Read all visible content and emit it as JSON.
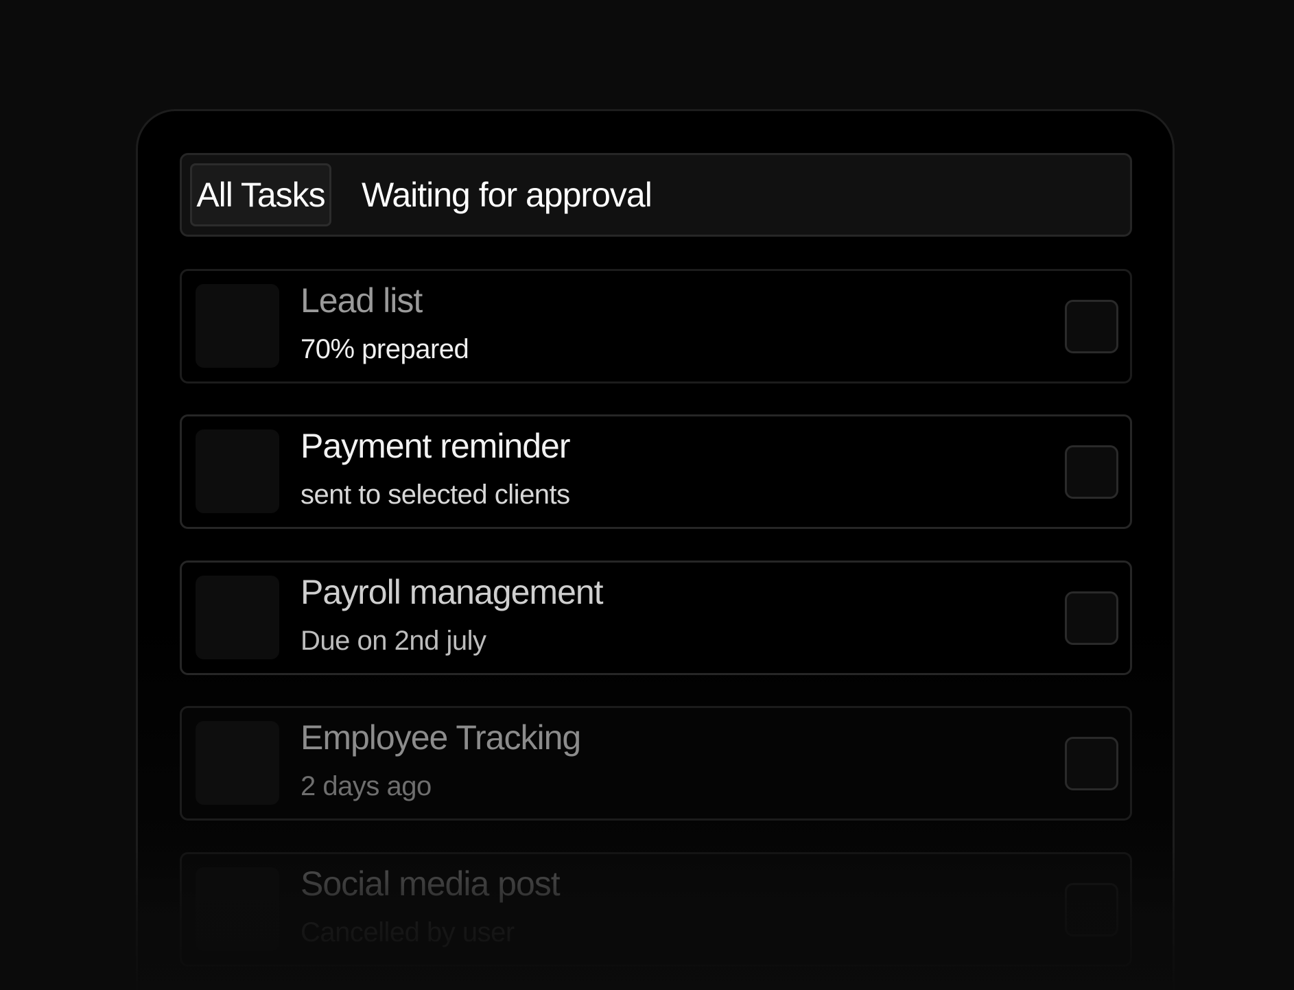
{
  "tabs": {
    "all_tasks": "All Tasks",
    "waiting_for_approval": "Waiting for approval"
  },
  "tasks": [
    {
      "title": "Lead list",
      "subtitle": "70% prepared"
    },
    {
      "title": "Payment reminder",
      "subtitle": "sent to selected clients"
    },
    {
      "title": "Payroll management",
      "subtitle": "Due on 2nd july"
    },
    {
      "title": "Employee Tracking",
      "subtitle": "2 days ago"
    },
    {
      "title": "Social media post",
      "subtitle": "Cancelled by user"
    }
  ],
  "colors": {
    "background": "#0b0b0b",
    "panel": "#000000",
    "border": "#262626",
    "active_tab": "#1a1a1a"
  }
}
